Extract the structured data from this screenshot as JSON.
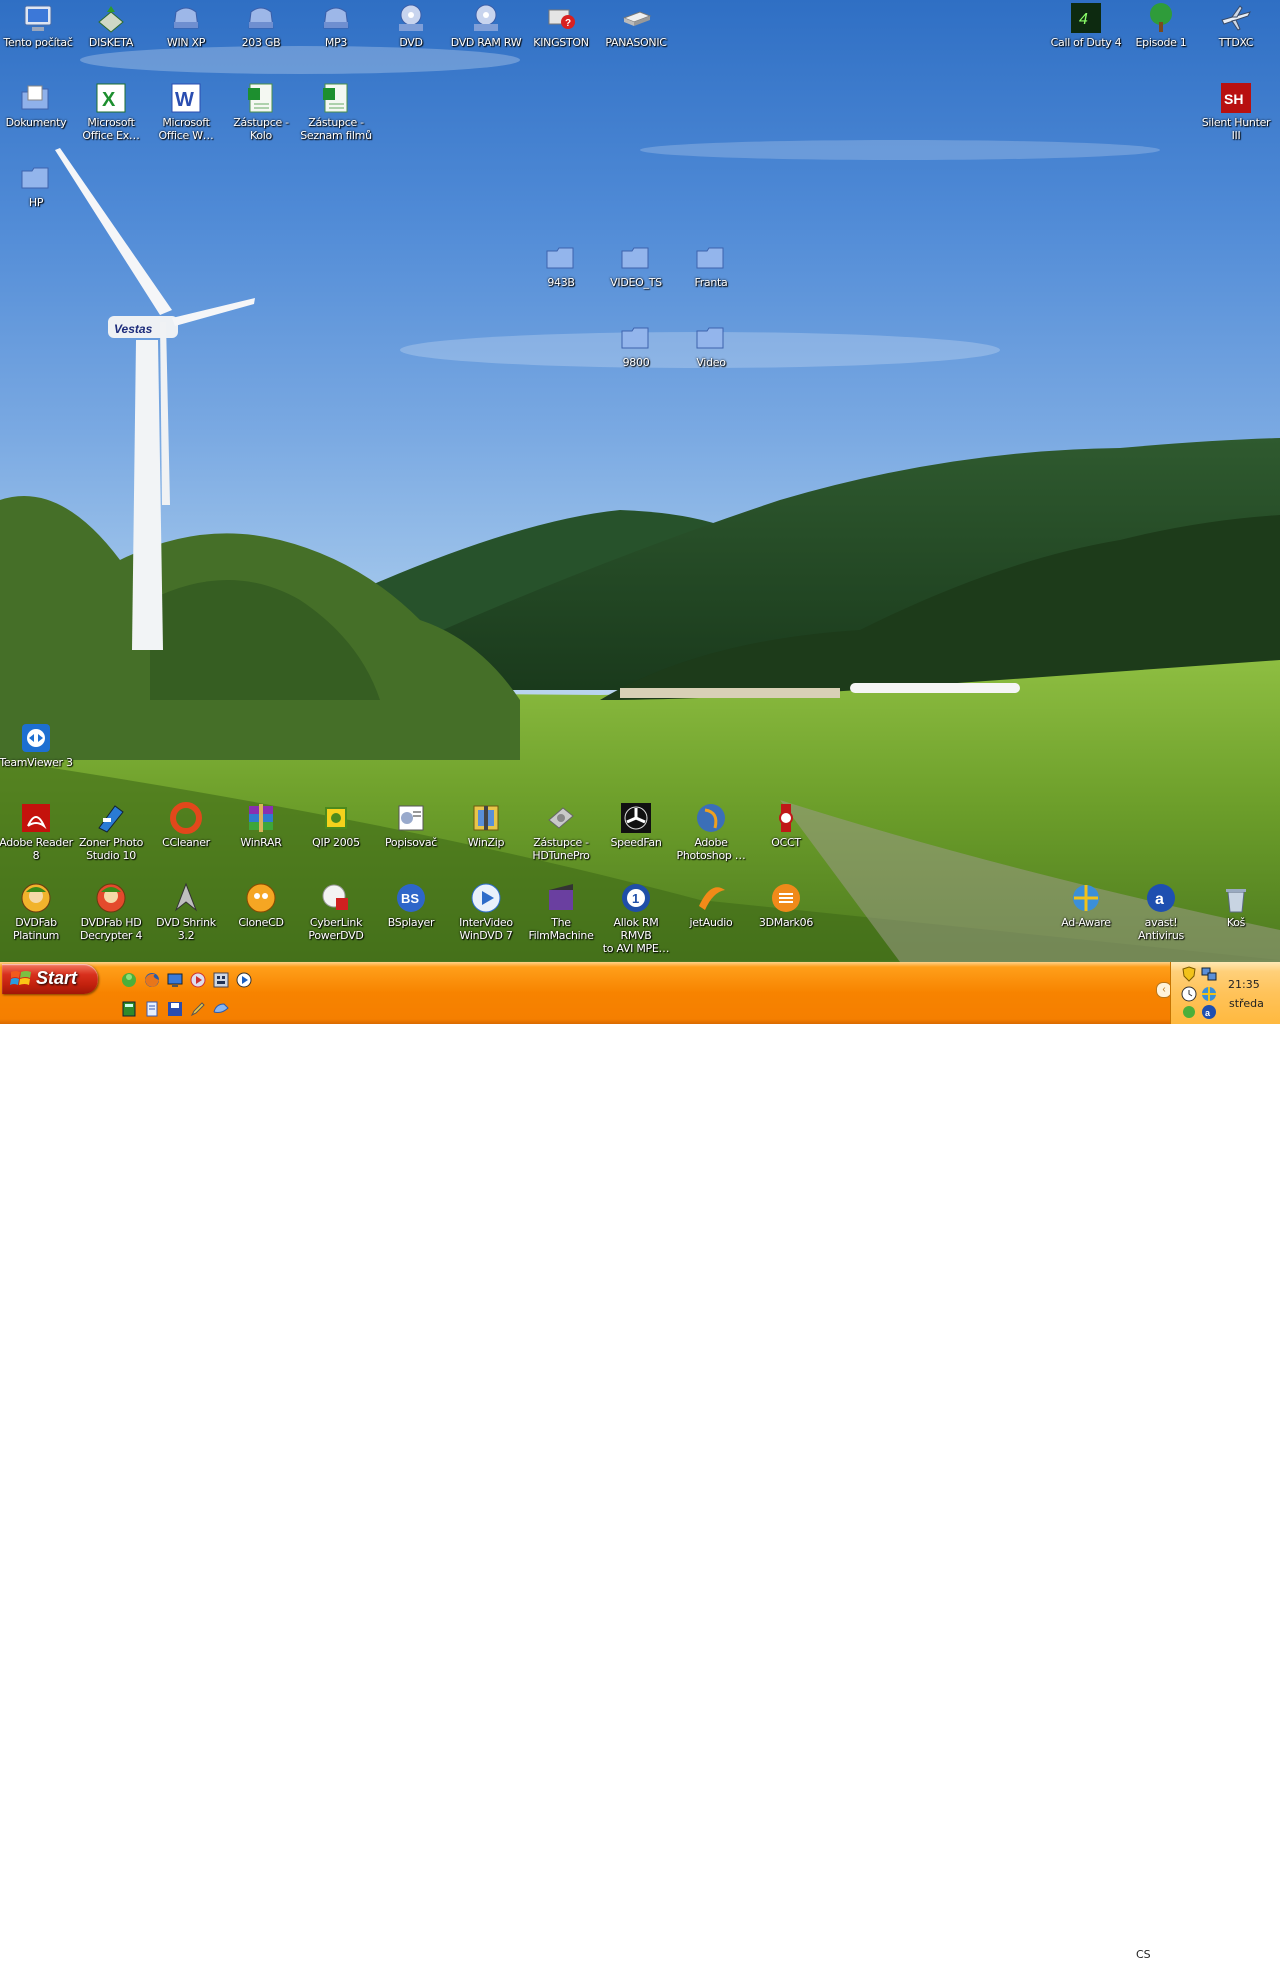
{
  "colors": {
    "taskbar": "#f78300",
    "start": "#c2210d",
    "tray": "#ffc35a"
  },
  "desktop": {
    "icons": [
      {
        "label": "Tento počítač",
        "icon": "computer-icon"
      },
      {
        "label": "DISKETA",
        "icon": "floppy-icon"
      },
      {
        "label": "WIN XP",
        "icon": "hard-drive-icon"
      },
      {
        "label": "203 GB",
        "icon": "hard-drive-icon"
      },
      {
        "label": "MP3",
        "icon": "hard-drive-icon"
      },
      {
        "label": "DVD",
        "icon": "dvd-drive-icon"
      },
      {
        "label": "DVD RAM RW",
        "icon": "dvd-drive-icon"
      },
      {
        "label": "KINGSTON",
        "icon": "removable-drive-icon"
      },
      {
        "label": "PANASONIC",
        "icon": "removable-drive-icon"
      },
      {
        "label": "Call of Duty 4",
        "icon": "cod4-icon"
      },
      {
        "label": "Episode 1",
        "icon": "tree-icon"
      },
      {
        "label": "TTDXC",
        "icon": "airplane-icon"
      },
      {
        "label": "Dokumenty",
        "icon": "documents-folder-icon"
      },
      {
        "label": "Microsoft\nOffice Ex…",
        "icon": "excel-icon"
      },
      {
        "label": "Microsoft\nOffice W…",
        "icon": "word-icon"
      },
      {
        "label": "Zástupce -\nKolo",
        "icon": "excel-sheet-icon"
      },
      {
        "label": "Zástupce -\nSeznam filmů",
        "icon": "excel-sheet-icon"
      },
      {
        "label": "Silent Hunter\nIII",
        "icon": "silent-hunter-icon"
      },
      {
        "label": "HP",
        "icon": "folder-icon"
      },
      {
        "label": "943B",
        "icon": "folder-icon"
      },
      {
        "label": "VIDEO_TS",
        "icon": "folder-icon"
      },
      {
        "label": "Franta",
        "icon": "folder-icon"
      },
      {
        "label": "9800",
        "icon": "folder-icon"
      },
      {
        "label": "Video",
        "icon": "folder-icon"
      },
      {
        "label": "TeamViewer 3",
        "icon": "teamviewer-icon"
      },
      {
        "label": "Adobe Reader\n8",
        "icon": "adobe-reader-icon"
      },
      {
        "label": "Zoner Photo\nStudio 10",
        "icon": "zoner-icon"
      },
      {
        "label": "CCleaner",
        "icon": "ccleaner-icon"
      },
      {
        "label": "WinRAR",
        "icon": "winrar-icon"
      },
      {
        "label": "QIP 2005",
        "icon": "qip-icon"
      },
      {
        "label": "Popisovač",
        "icon": "popisovac-icon"
      },
      {
        "label": "WinZip",
        "icon": "winzip-icon"
      },
      {
        "label": "Zástupce -\nHDTunePro",
        "icon": "hdtune-icon"
      },
      {
        "label": "SpeedFan",
        "icon": "fan-icon"
      },
      {
        "label": "Adobe\nPhotoshop …",
        "icon": "photoshop-icon"
      },
      {
        "label": "OCCT",
        "icon": "occt-icon"
      },
      {
        "label": "DVDFab\nPlatinum",
        "icon": "dvdfab-icon"
      },
      {
        "label": "DVDFab HD\nDecrypter 4",
        "icon": "dvdfab-icon"
      },
      {
        "label": "DVD Shrink 3.2",
        "icon": "dvdshrink-icon"
      },
      {
        "label": "CloneCD",
        "icon": "clonecd-icon"
      },
      {
        "label": "CyberLink\nPowerDVD",
        "icon": "powerdvd-icon"
      },
      {
        "label": "BSplayer",
        "icon": "bsplayer-icon"
      },
      {
        "label": "InterVideo\nWinDVD 7",
        "icon": "play-icon"
      },
      {
        "label": "The\nFilmMachine",
        "icon": "film-icon"
      },
      {
        "label": "Allok RM RMVB\nto AVI MPE…",
        "icon": "allok-icon"
      },
      {
        "label": "jetAudio",
        "icon": "jetaudio-icon"
      },
      {
        "label": "3DMark06",
        "icon": "3dmark-icon"
      },
      {
        "label": "Ad-Aware",
        "icon": "adaware-icon"
      },
      {
        "label": "avast!\nAntivirus",
        "icon": "avast-icon"
      },
      {
        "label": "Koš",
        "icon": "recycle-bin-icon"
      }
    ]
  },
  "taskbar": {
    "start_label": "Start",
    "quick_launch": [
      "msn-icon",
      "firefox-icon",
      "desktop-icon",
      "media-icon",
      "network-icon",
      "player-icon",
      "calc-icon",
      "notepad-icon",
      "save-icon",
      "pencil-icon",
      "ie-icon"
    ],
    "language": "CS",
    "clock_time": "21:35",
    "clock_day": "středa"
  }
}
